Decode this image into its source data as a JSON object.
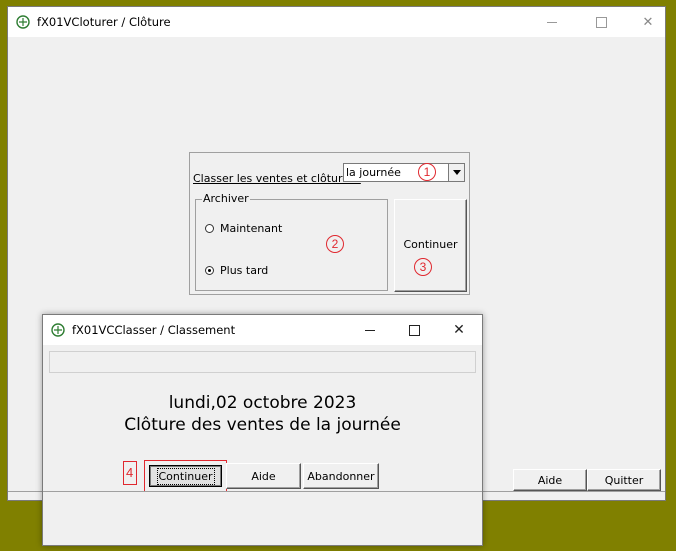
{
  "main_window": {
    "title": "fX01VCloturer / Clôture",
    "min_glyph": "—",
    "close_glyph": "✕"
  },
  "options": {
    "classer_label": "Classer les ventes et clôturer :",
    "period_value": "la journée",
    "archive_legend": "Archiver",
    "radio_now": "Maintenant",
    "radio_later": "Plus tard",
    "radio_later_selected": true,
    "continue_label": "Continuer"
  },
  "main_bottom": {
    "help_label": "Aide",
    "quit_label": "Quitter"
  },
  "annotations": {
    "n1": "1",
    "n2": "2",
    "n3": "3",
    "n4": "4",
    "color": "#e0282f"
  },
  "dialog": {
    "title": "fX01VCClasser / Classement",
    "min_glyph": "—",
    "close_glyph": "✕",
    "date_line": "lundi,02 octobre 2023",
    "message_line": "Clôture des ventes de la journée",
    "continue_label": "Continuer",
    "help_label": "Aide",
    "abort_label": "Abandonner"
  },
  "colors": {
    "desktop": "#808000",
    "window": "#f0f0f0",
    "annotation": "#e0282f"
  }
}
